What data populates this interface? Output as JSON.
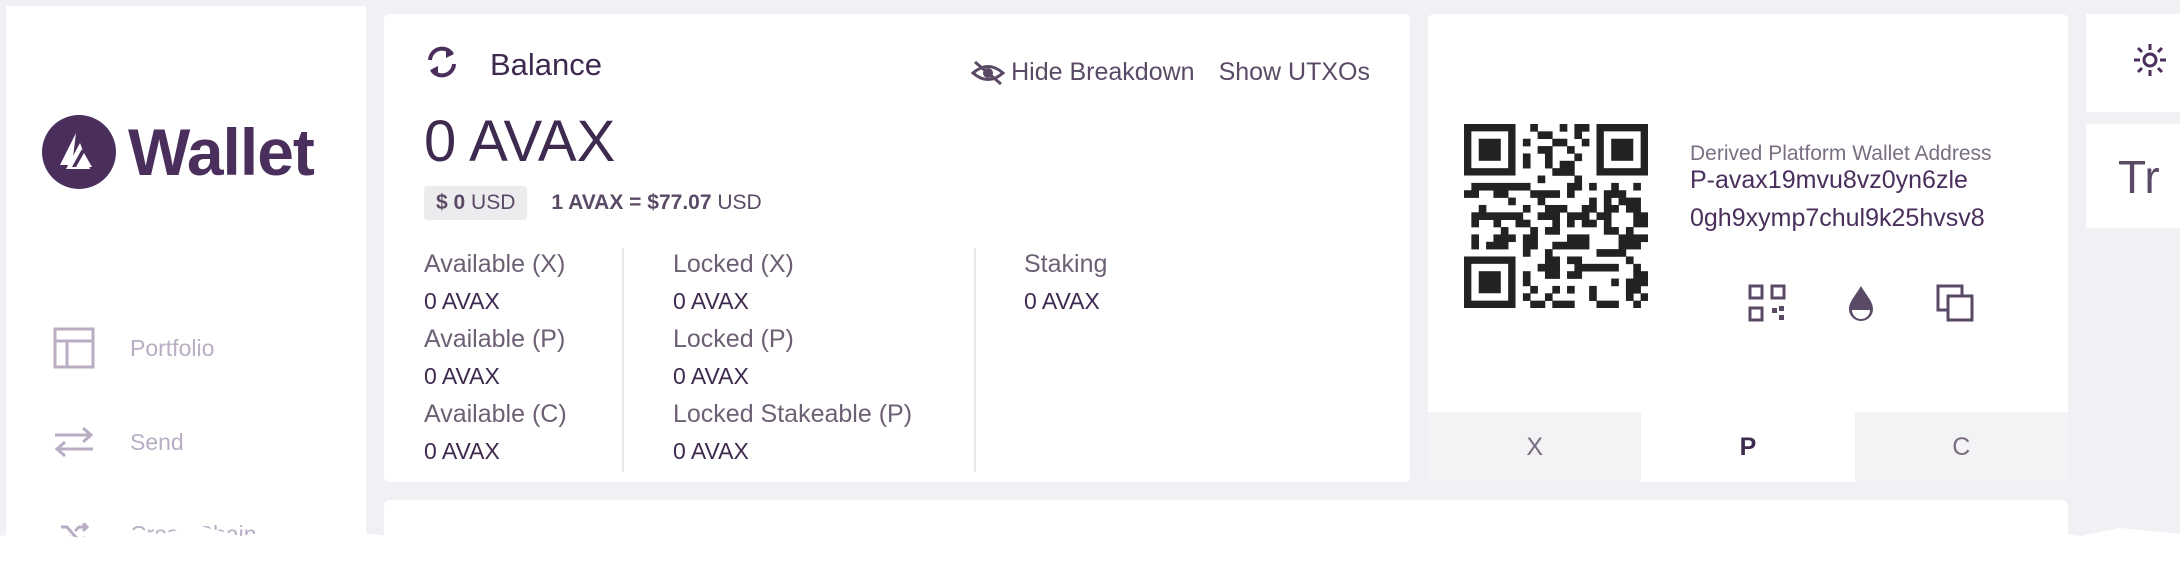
{
  "app": {
    "logo_text": "Wallet"
  },
  "sidebar": {
    "items": [
      {
        "label": "Portfolio",
        "icon": "portfolio-icon"
      },
      {
        "label": "Send",
        "icon": "send-icon"
      },
      {
        "label": "Cross Chain",
        "icon": "cross-chain-icon"
      }
    ]
  },
  "balance": {
    "title": "Balance",
    "hide_breakdown": "Hide Breakdown",
    "show_utxos": "Show UTXOs",
    "amount": "0 AVAX",
    "usd_value": "$ 0",
    "usd_unit": "USD",
    "rate_prefix": "1 AVAX = ",
    "rate_value": "$77.07",
    "rate_unit": " USD",
    "breakdown": {
      "col1": [
        {
          "label": "Available (X)",
          "value": "0 AVAX"
        },
        {
          "label": "Available (P)",
          "value": "0 AVAX"
        },
        {
          "label": "Available (C)",
          "value": "0 AVAX"
        }
      ],
      "col2": [
        {
          "label": "Locked (X)",
          "value": "0 AVAX"
        },
        {
          "label": "Locked (P)",
          "value": "0 AVAX"
        },
        {
          "label": "Locked Stakeable (P)",
          "value": "0 AVAX"
        }
      ],
      "col3": [
        {
          "label": "Staking",
          "value": "0 AVAX"
        }
      ]
    }
  },
  "address": {
    "title": "Derived Platform Wallet Address",
    "line1": "P-avax19mvu8vz0yn6zle",
    "line2": "0gh9xymp7chul9k25hvsv8",
    "tabs": [
      "X",
      "P",
      "C"
    ],
    "active_tab": "P"
  },
  "right_panel": {
    "partial_text": "Tr"
  },
  "colors": {
    "brand": "#4a2f5c",
    "muted": "#b8adc3",
    "background": "#f1f0f4"
  }
}
